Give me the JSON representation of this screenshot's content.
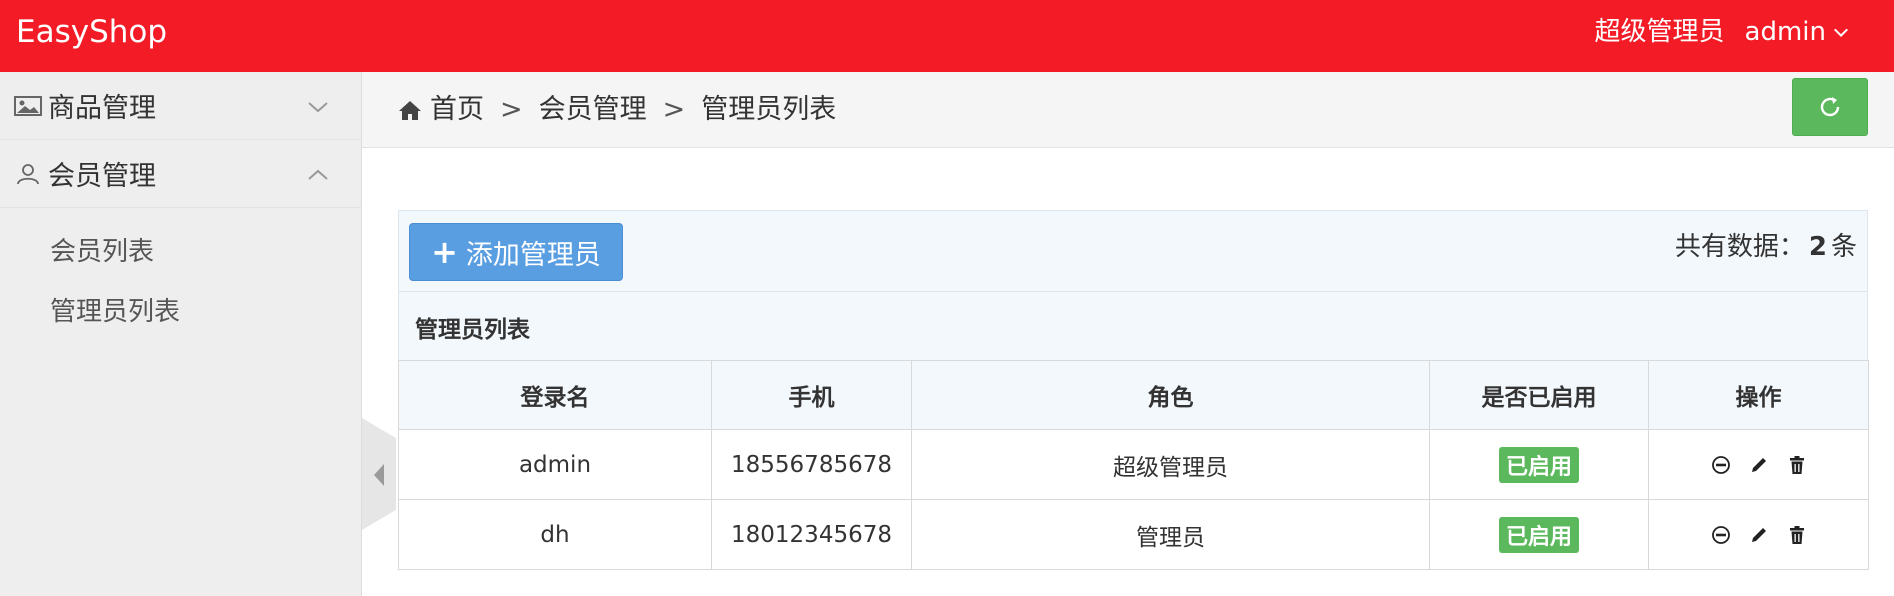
{
  "header": {
    "brand": "EasyShop",
    "role": "超级管理员",
    "username": "admin"
  },
  "sidebar": {
    "groups": [
      {
        "label": "商品管理",
        "icon": "image-icon",
        "expanded": false
      },
      {
        "label": "会员管理",
        "icon": "user-icon",
        "expanded": true,
        "items": [
          {
            "label": "会员列表"
          },
          {
            "label": "管理员列表"
          }
        ]
      }
    ]
  },
  "breadcrumb": {
    "home": "首页",
    "level1": "会员管理",
    "level2": "管理员列表",
    "separator": ">"
  },
  "toolbar": {
    "add_label": "添加管理员",
    "total_prefix": "共有数据：",
    "total_count": "2",
    "total_suffix": "条"
  },
  "table": {
    "caption": "管理员列表",
    "headers": [
      "登录名",
      "手机",
      "角色",
      "是否已启用",
      "操作"
    ],
    "rows": [
      {
        "login": "admin",
        "phone": "18556785678",
        "role": "超级管理员",
        "status": "已启用"
      },
      {
        "login": "dh",
        "phone": "18012345678",
        "role": "管理员",
        "status": "已启用"
      }
    ]
  },
  "colors": {
    "header_bg": "#f31c26",
    "primary": "#5a9ee2",
    "success": "#5cb85c"
  }
}
